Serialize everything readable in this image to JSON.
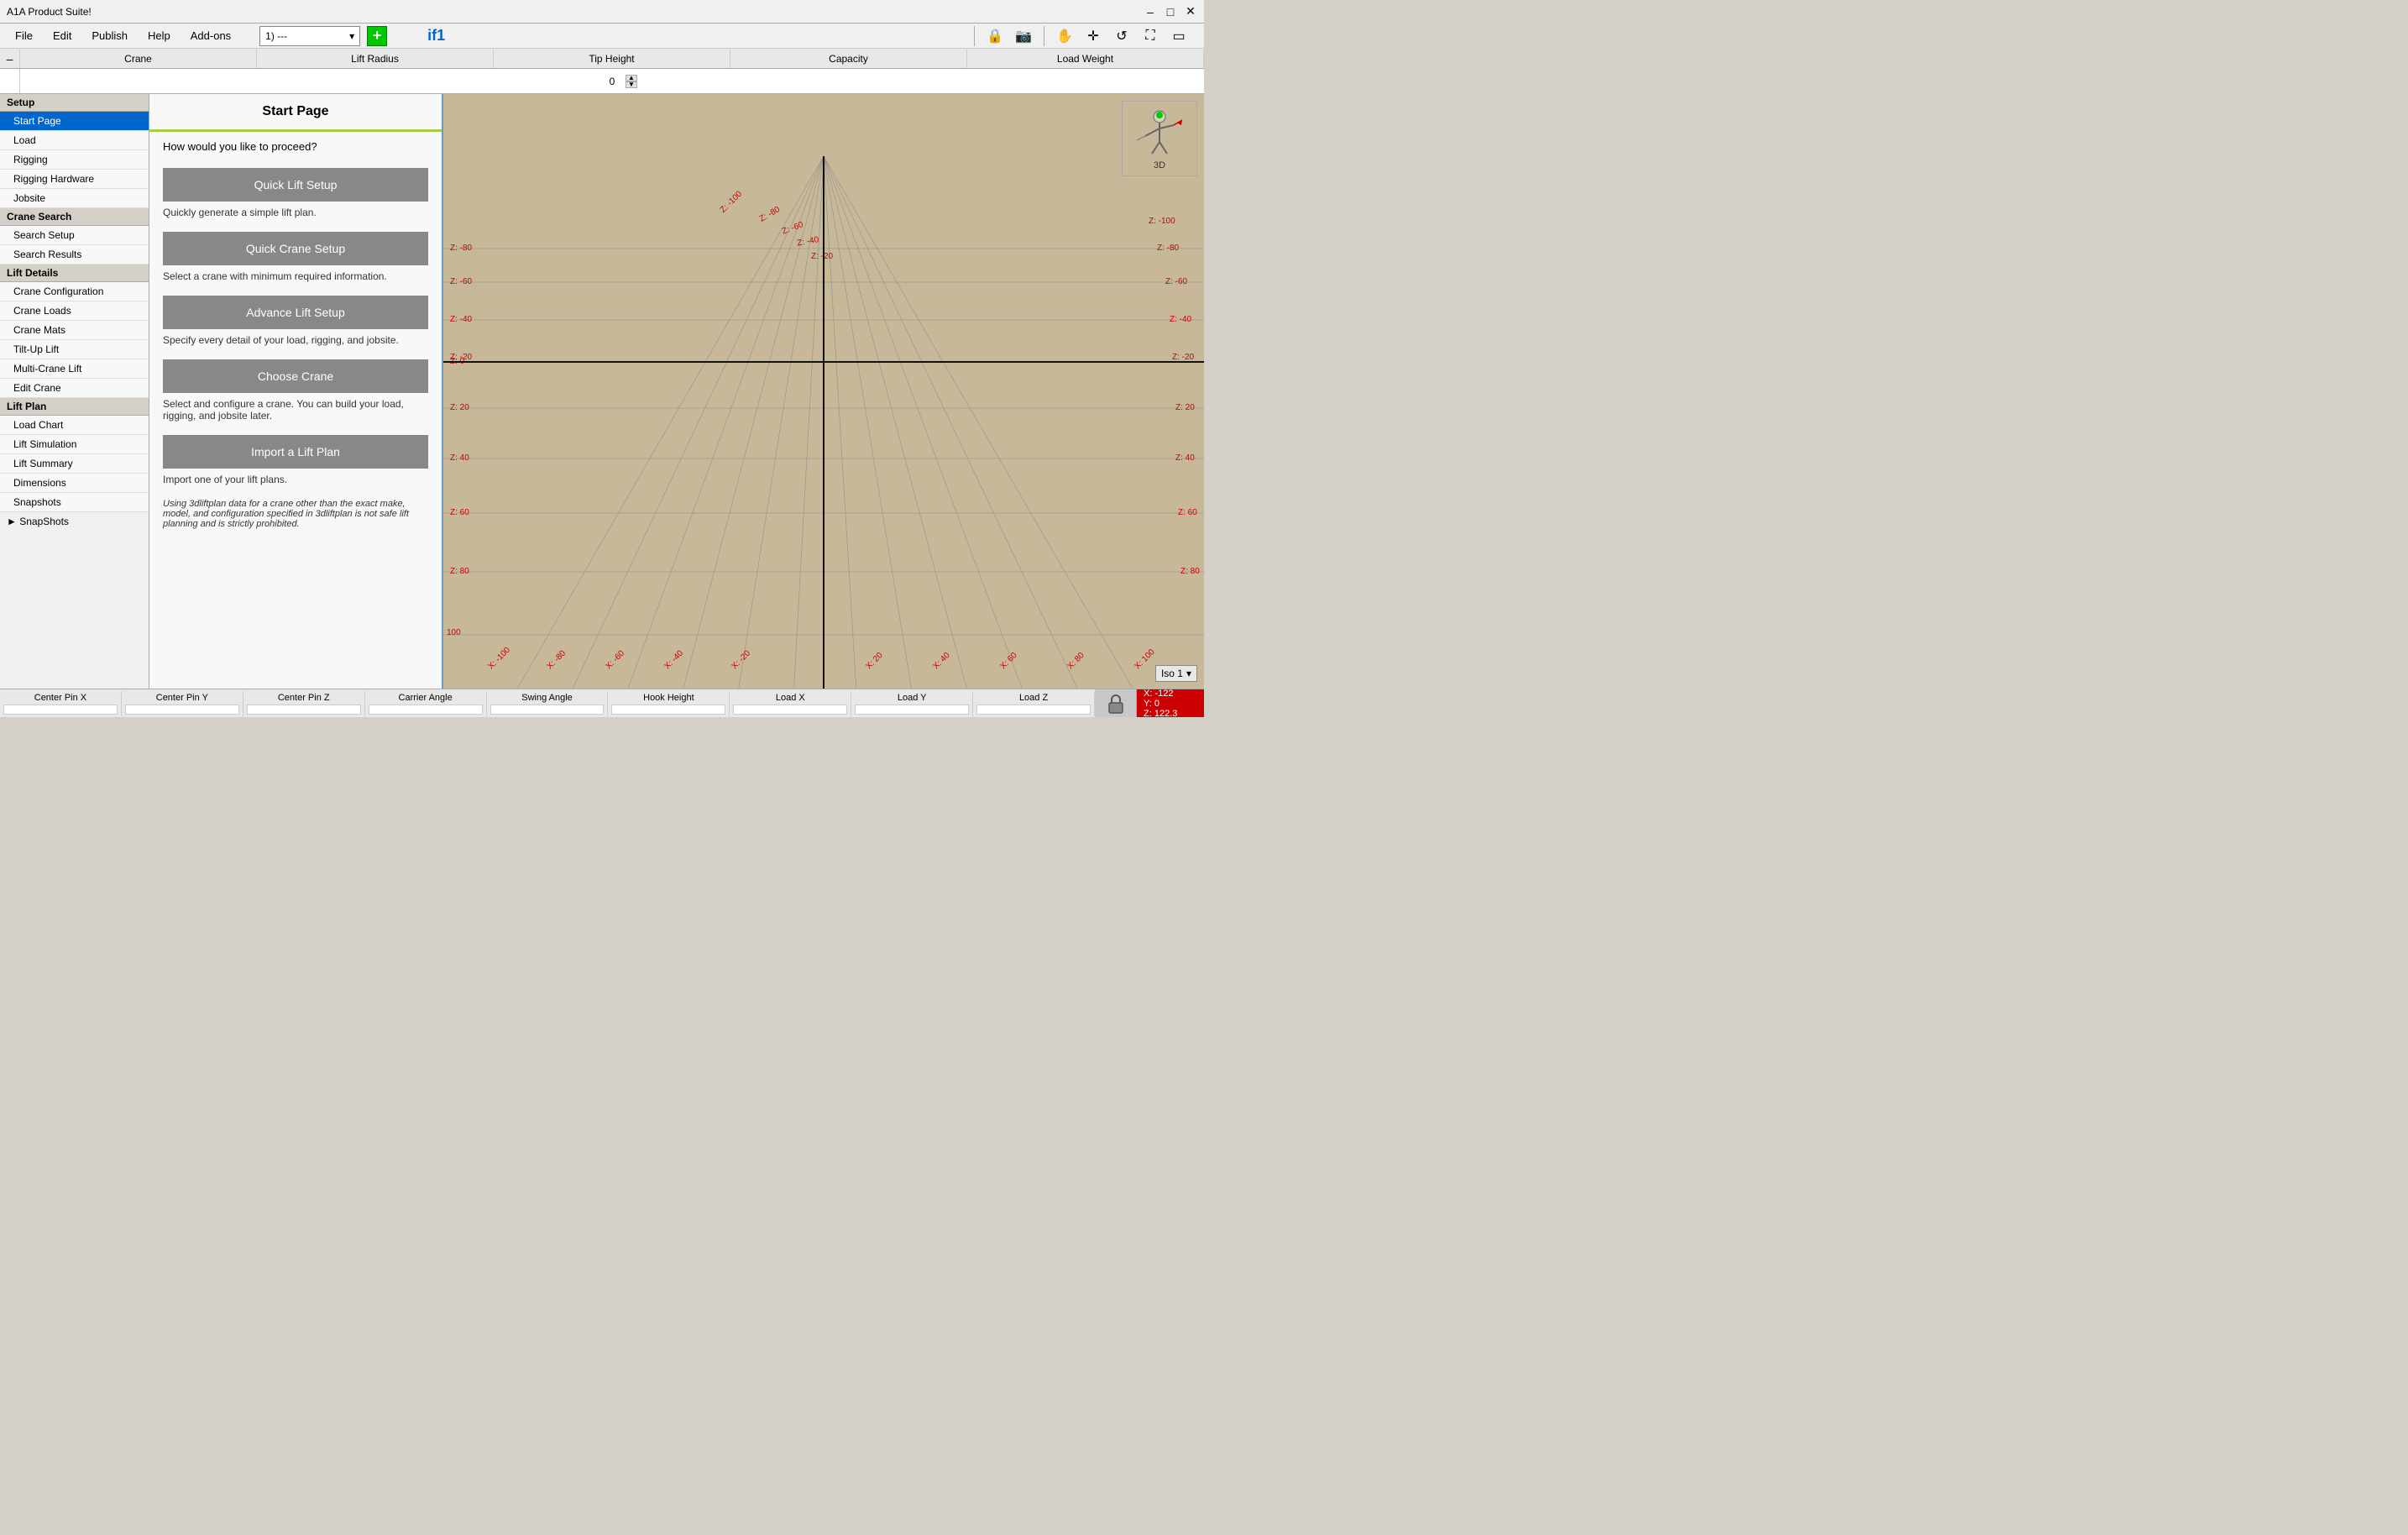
{
  "titlebar": {
    "title": "A1A Product Suite!",
    "controls": [
      "–",
      "□",
      "✕"
    ]
  },
  "menubar": {
    "items": [
      "File",
      "Edit",
      "Publish",
      "Help",
      "Add-ons"
    ],
    "dropdown": "1) ---",
    "instance": "if1"
  },
  "columns": {
    "minus": "–",
    "headers": [
      "Crane",
      "Lift Radius",
      "Tip Height",
      "Capacity",
      "Load Weight"
    ]
  },
  "numrow": {
    "value": "0"
  },
  "sidebar": {
    "sections": [
      {
        "header": "Setup",
        "items": [
          "Start Page",
          "Load",
          "Rigging",
          "Rigging Hardware",
          "Jobsite"
        ]
      },
      {
        "header": "Crane Search",
        "items": [
          "Search Setup",
          "Search Results"
        ]
      },
      {
        "header": "Lift Details",
        "items": [
          "Crane Configuration",
          "Crane Loads",
          "Crane Mats",
          "Tilt-Up Lift",
          "Multi-Crane Lift",
          "Edit Crane"
        ]
      },
      {
        "header": "Lift Plan",
        "items": [
          "Load Chart",
          "Lift Simulation",
          "Lift Summary",
          "Dimensions",
          "Snapshots"
        ]
      }
    ],
    "snapshots": "► SnapShots",
    "active_item": "Start Page"
  },
  "startpage": {
    "title": "Start Page",
    "subtitle": "How would you like to proceed?",
    "buttons": [
      {
        "label": "Quick Lift Setup",
        "desc": "Quickly generate a simple lift plan."
      },
      {
        "label": "Quick Crane Setup",
        "desc": "Select a crane with minimum required information."
      },
      {
        "label": "Advance Lift Setup",
        "desc": "Specify every detail of your load, rigging, and jobsite."
      },
      {
        "label": "Choose Crane",
        "desc": "Select and configure a crane. You can build your load, rigging, and jobsite later."
      },
      {
        "label": "Import a Lift Plan",
        "desc": "Import one of your lift plans."
      }
    ],
    "disclaimer": "Using 3dliftplan data for a crane other than the exact make, model, and configuration specified in 3dliftplan is not safe lift planning and is strictly prohibited."
  },
  "toolbar_icons": [
    "🔒",
    "📷",
    "✋",
    "✛",
    "↺",
    "⛶",
    "▭"
  ],
  "view3d": {
    "label": "3D",
    "view": "Iso 1"
  },
  "statusbar": {
    "cols": [
      "Center Pin X",
      "Center Pin Y",
      "Center Pin Z",
      "Carrier Angle",
      "Swing Angle",
      "Hook Height",
      "Load X",
      "Load Y",
      "Load Z"
    ]
  },
  "coords": {
    "x": "X: -122",
    "y": "Y: 0",
    "z": "Z: 122.3"
  },
  "grid": {
    "z_labels_left": [
      "Z: -100",
      "Z: -80",
      "Z: -60",
      "Z: -40",
      "Z: -20",
      "Z: 0",
      "Z: 20",
      "Z: 40",
      "Z: 60",
      "Z: 80"
    ],
    "z_labels_right": [
      "Z: -100",
      "Z: -80",
      "Z: -60",
      "Z: -40",
      "Z: -20",
      "Z: 20",
      "Z: 40",
      "Z: 60",
      "Z: 80"
    ],
    "x_labels": [
      "X: -100",
      "X: -80",
      "X: -60",
      "X: -40",
      "X: -20",
      "X: 20",
      "X: 40",
      "X: 60",
      "X: 80",
      "X: 100"
    ],
    "x_label_100": "100"
  }
}
